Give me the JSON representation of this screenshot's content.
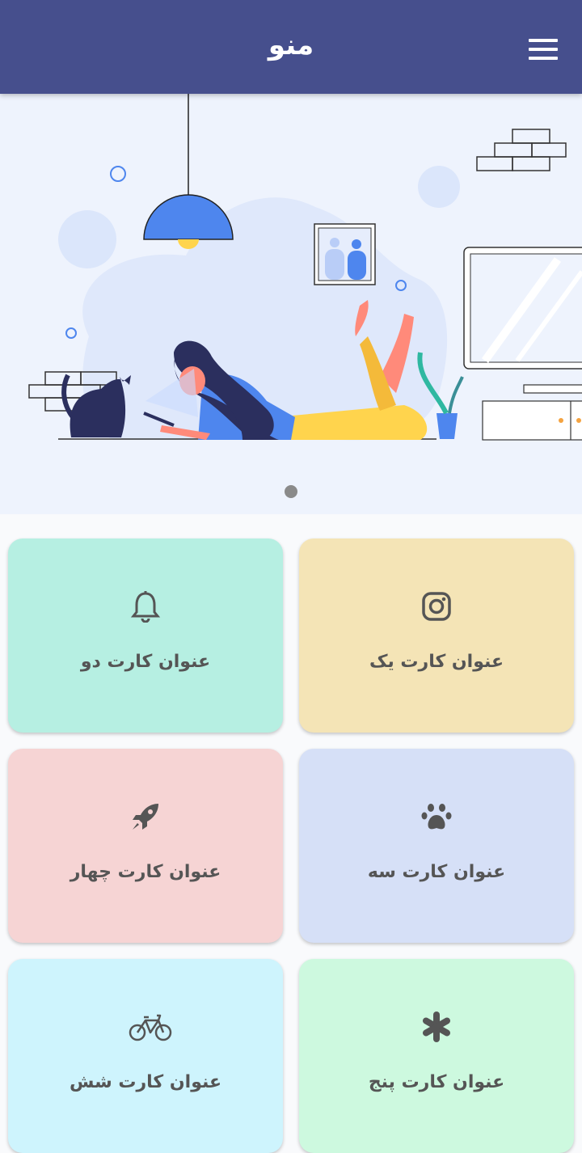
{
  "appbar": {
    "title": "منو",
    "menu_icon": "hamburger-menu-icon",
    "background": "#464f8d"
  },
  "hero": {
    "background": "#eef3fd",
    "pager_dots": 1
  },
  "cards": [
    {
      "title": "عنوان کارت یک",
      "icon": "instagram-icon",
      "color": "#f4e4b6"
    },
    {
      "title": "عنوان کارت دو",
      "icon": "bell-icon",
      "color": "#b6efe2"
    },
    {
      "title": "عنوان کارت سه",
      "icon": "paw-icon",
      "color": "#d6e0f7"
    },
    {
      "title": "عنوان کارت چهار",
      "icon": "rocket-icon",
      "color": "#f6d4d4"
    },
    {
      "title": "عنوان کارت پنج",
      "icon": "asterisk-icon",
      "color": "#cdf9df"
    },
    {
      "title": "عنوان کارت شش",
      "icon": "bicycle-icon",
      "color": "#cef4fd"
    }
  ]
}
